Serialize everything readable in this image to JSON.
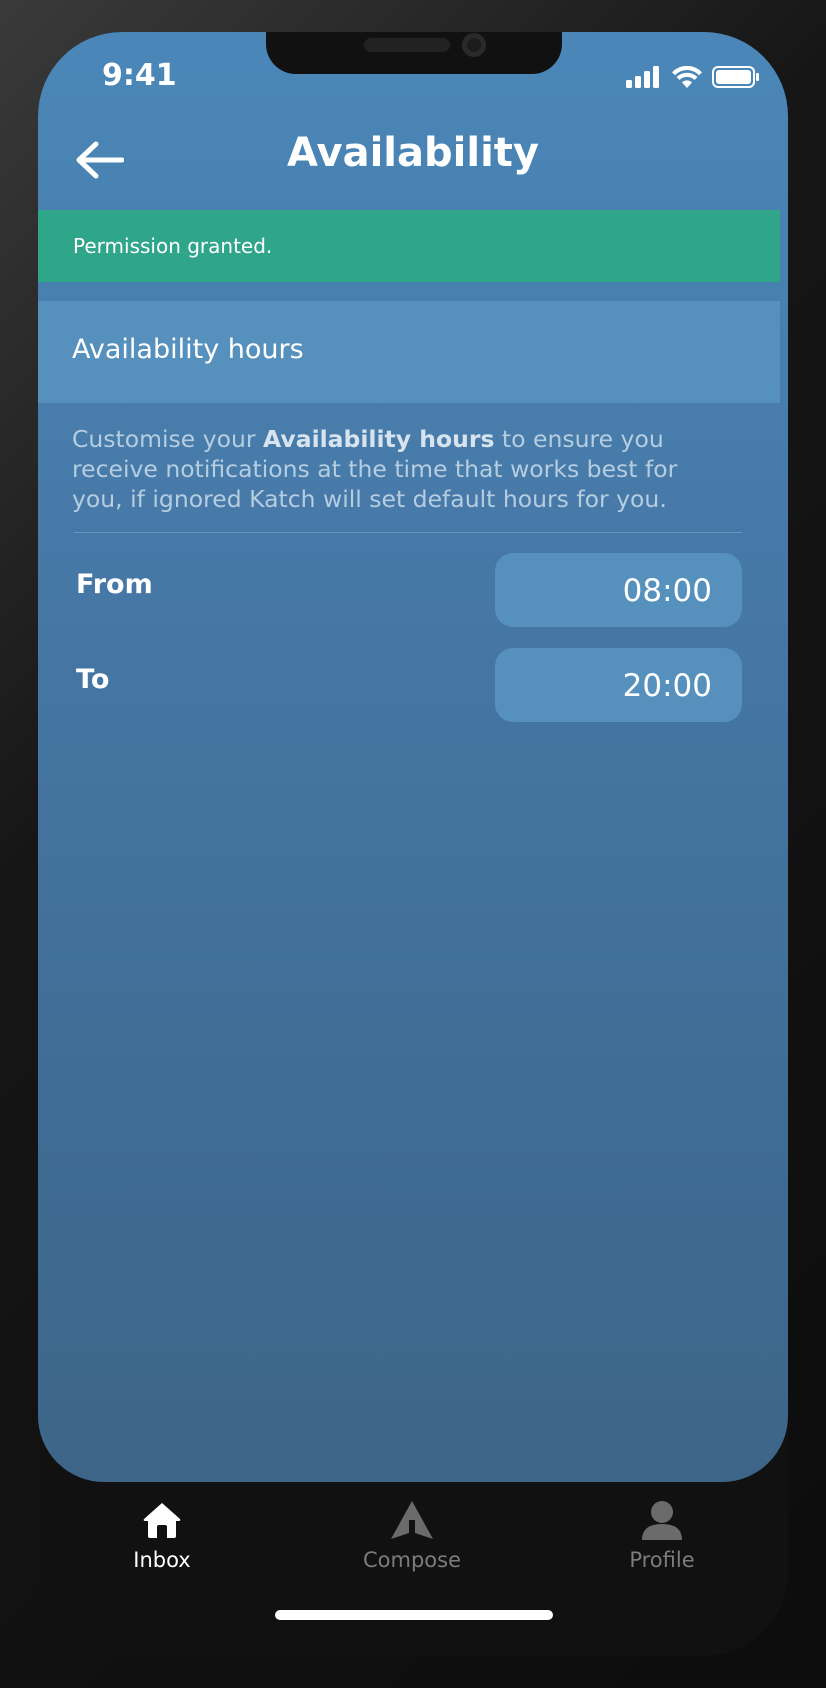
{
  "status_bar": {
    "time": "9:41"
  },
  "header": {
    "title": "Availability"
  },
  "banner": {
    "text": "Permission granted."
  },
  "section": {
    "title": "Availability hours"
  },
  "description": {
    "prefix": "Customise your ",
    "bold": "Availability hours",
    "suffix": " to ensure you receive notifications at the time that works best for you, if ignored Katch will set default hours for you."
  },
  "hours": {
    "from_label": "From",
    "from_value": "08:00",
    "to_label": "To",
    "to_value": "20:00"
  },
  "tabbar": {
    "tabs": [
      {
        "label": "Inbox",
        "icon": "home-icon",
        "active": true
      },
      {
        "label": "Compose",
        "icon": "send-icon",
        "active": false
      },
      {
        "label": "Profile",
        "icon": "user-icon",
        "active": false
      }
    ]
  },
  "colors": {
    "banner_bg": "#2fa58a",
    "screen_bg": "#4677a5",
    "field_bg": "#5690bd"
  }
}
